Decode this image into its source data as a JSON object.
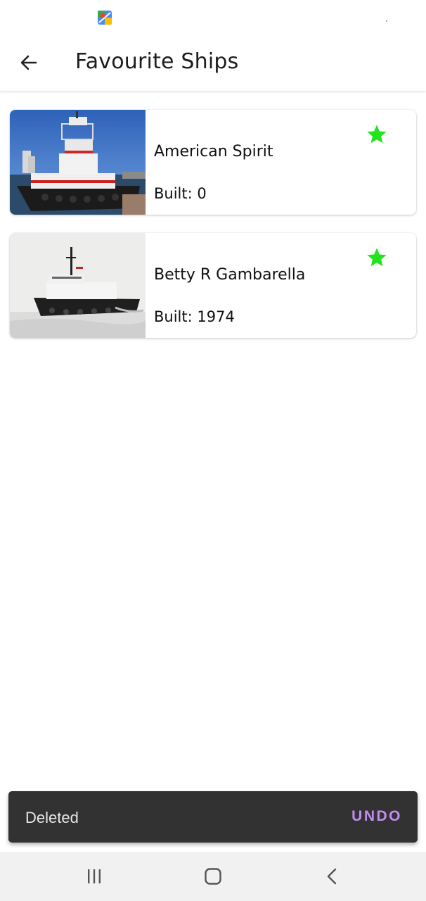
{
  "app_bar": {
    "title": "Favourite Ships",
    "back_icon": "arrow-left-icon"
  },
  "ships": [
    {
      "name": "American Spirit",
      "built_prefix": "Built: ",
      "built_value": "0",
      "favorite": true,
      "star_color": "#22e31c",
      "photo_icon": "tugboat-photo"
    },
    {
      "name": "Betty R Gambarella",
      "built_prefix": "Built: ",
      "built_value": "1974",
      "favorite": true,
      "star_color": "#22e31c",
      "photo_icon": "tugboat-photo"
    }
  ],
  "snackbar": {
    "message": "Deleted",
    "action": "UNDO",
    "action_color": "#c38cf0"
  },
  "nav": {
    "icons": [
      "recents-icon",
      "home-icon",
      "back-icon"
    ]
  },
  "colors": {
    "accent_star": "#22e31c",
    "snackbar_bg": "#323232"
  }
}
